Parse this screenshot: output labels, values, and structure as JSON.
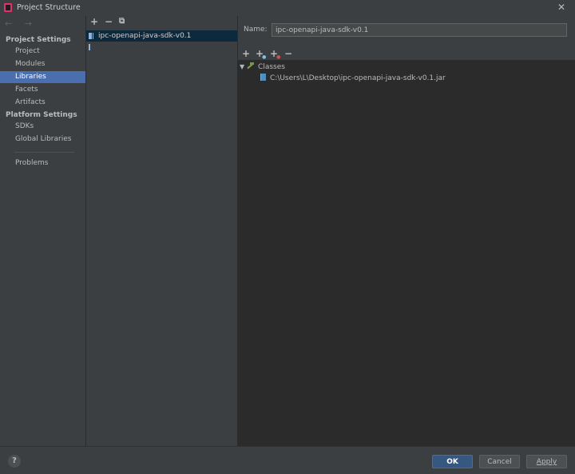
{
  "window": {
    "title": "Project Structure",
    "close_glyph": "✕"
  },
  "sidebar": {
    "nav_arrows": "← →",
    "sections": [
      {
        "heading": "Project Settings",
        "items": [
          "Project",
          "Modules",
          "Libraries",
          "Facets",
          "Artifacts"
        ]
      },
      {
        "heading": "Platform Settings",
        "items": [
          "SDKs",
          "Global Libraries"
        ]
      }
    ],
    "selected": "Libraries",
    "problems": "Problems"
  },
  "libraries": {
    "toolbar": {
      "add": "+",
      "remove": "−",
      "copy": "⧉"
    },
    "items": [
      {
        "label": "ipc-openapi-java-sdk-v0.1",
        "icon": "library-icon"
      }
    ]
  },
  "detail": {
    "name_label": "Name:",
    "name_value": "ipc-openapi-java-sdk-v0.1",
    "toolbar": {
      "add": "+",
      "add_alt": "+",
      "add_excluded": "+",
      "remove": "−"
    },
    "tree": {
      "root": {
        "toggle": "▼",
        "label": "Classes",
        "icon": "classes-icon"
      },
      "children": [
        {
          "label": "C:\\Users\\L\\Desktop\\ipc-openapi-java-sdk-v0.1.jar",
          "icon": "jar-icon"
        }
      ]
    }
  },
  "footer": {
    "help": "?",
    "ok": "OK",
    "cancel": "Cancel",
    "apply": "Apply"
  },
  "colors": {
    "background": "#3c3f41",
    "selection": "#4b6eaf",
    "list_selection": "#0d293e",
    "ok_button": "#365880",
    "tree_bg": "#2b2b2b"
  }
}
